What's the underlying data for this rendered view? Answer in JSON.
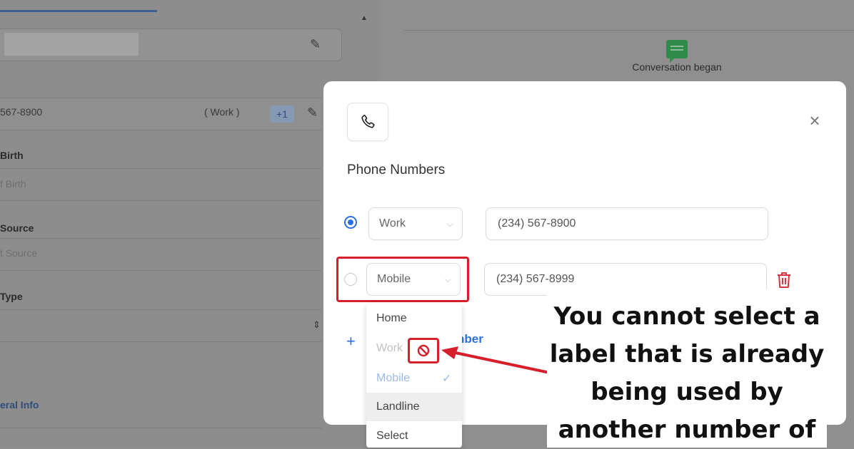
{
  "background": {
    "phone_partial": "567-8900",
    "phone_label": "( Work )",
    "phone_more": "+1",
    "dob_label": "Birth",
    "dob_placeholder": "f Birth",
    "source_label": "Source",
    "source_placeholder": "t Source",
    "type_label": "Type",
    "general_info_link": "eral Info",
    "timeline_event": "Conversation began"
  },
  "modal": {
    "title": "Phone Numbers",
    "rows": [
      {
        "label": "Work",
        "number": "(234) 567-8900",
        "primary": true
      },
      {
        "label": "Mobile",
        "number": "(234) 567-8999",
        "primary": false
      }
    ],
    "add_number_partial": "nber",
    "dropdown_options": [
      {
        "label": "Home",
        "state": "normal"
      },
      {
        "label": "Work",
        "state": "disabled"
      },
      {
        "label": "Mobile",
        "state": "selected"
      },
      {
        "label": "Landline",
        "state": "hover"
      },
      {
        "label": "Select",
        "state": "normal"
      }
    ]
  },
  "annotation": {
    "callout_lines": [
      "You cannot select a",
      "label that is already",
      "being used by",
      "another number of"
    ]
  },
  "colors": {
    "accent_blue": "#2d6fe0",
    "highlight_red": "#d61f2b",
    "chat_green": "#2f8b4a"
  },
  "icons": [
    "pencil-icon",
    "phone-icon",
    "close-icon",
    "chevron-down-icon",
    "trash-icon",
    "ban-icon",
    "checkmark-icon",
    "chat-icon",
    "sort-icon",
    "arrow-annotation"
  ]
}
